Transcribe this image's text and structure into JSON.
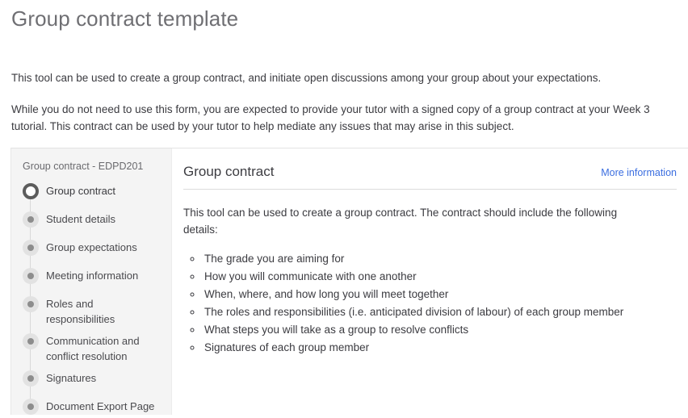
{
  "page": {
    "title": "Group contract template",
    "intro_paragraphs": [
      "This tool can be used to create a group contract, and initiate open discussions among your group about your expectations.",
      "While you do not need to use this form, you are expected to provide your tutor with a signed copy of a group contract at your Week 3 tutorial. This contract can be used by your tutor to help mediate any issues that may arise in this subject."
    ]
  },
  "sidebar": {
    "title": "Group contract - EDPD201",
    "steps": [
      {
        "label": "Group contract",
        "active": true
      },
      {
        "label": "Student details",
        "active": false
      },
      {
        "label": "Group expectations",
        "active": false
      },
      {
        "label": "Meeting information",
        "active": false
      },
      {
        "label": "Roles and responsibilities",
        "active": false
      },
      {
        "label": "Communication and conflict resolution",
        "active": false
      },
      {
        "label": "Signatures",
        "active": false
      },
      {
        "label": "Document Export Page",
        "active": false
      }
    ]
  },
  "panel": {
    "title": "Group contract",
    "more_information_label": "More information",
    "body_text": "This tool can be used to create a group contract. The contract should include the following details:",
    "details": [
      "The grade you are aiming for",
      "How you will communicate with one another",
      "When, where, and how long you will meet together",
      "The roles and responsibilities (i.e. anticipated division of labour) of each group member",
      "What steps you will take as a group to resolve conflicts",
      "Signatures of each group member"
    ]
  },
  "colors": {
    "page_title": "#6f6f73",
    "link": "#3b6ee0",
    "sidebar_bg": "#f4f4f4",
    "body_text": "#3b3b40",
    "active_marker": "#5c5c5c",
    "inactive_marker": "#8d8d8d"
  }
}
